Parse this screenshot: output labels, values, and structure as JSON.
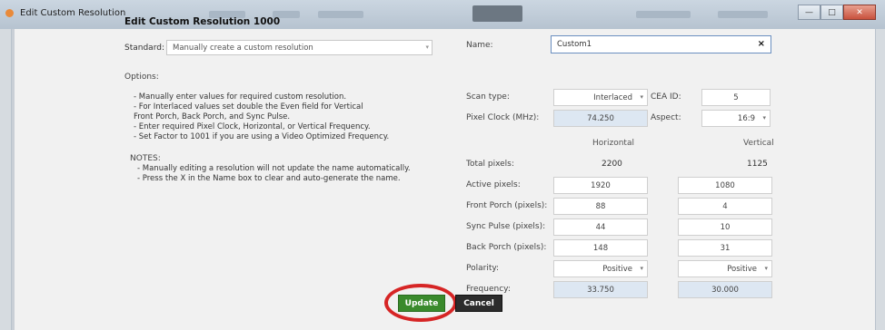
{
  "window": {
    "title": "Edit Custom Resolution"
  },
  "heading": "Edit Custom Resolution 1000",
  "standard": {
    "label": "Standard:",
    "value": "Manually create a custom resolution"
  },
  "options": {
    "label": "Options:",
    "lines": [
      "- Manually enter values for required custom resolution.",
      "- For Interlaced values set double the Even field for Vertical",
      "  Front Porch, Back Porch, and Sync Pulse.",
      "- Enter required Pixel Clock, Horizontal, or Vertical Frequency.",
      "- Set Factor to 1001 if you are using a Video Optimized Frequency."
    ]
  },
  "notes": {
    "label": "NOTES:",
    "lines": [
      "- Manually editing a resolution will not update the name automatically.",
      "- Press the X in the Name box to clear and auto-generate the name."
    ]
  },
  "form": {
    "name_label": "Name:",
    "name_value": "Custom1",
    "name_clear": "×",
    "scan_type_label": "Scan type:",
    "scan_type_value": "Interlaced",
    "cea_label": "CEA ID:",
    "cea_value": "5",
    "pixel_clock_label": "Pixel Clock (MHz):",
    "pixel_clock_value": "74.250",
    "aspect_label": "Aspect:",
    "aspect_value": "16:9",
    "horizontal_label": "Horizontal",
    "vertical_label": "Vertical",
    "rows": {
      "total": {
        "label": "Total pixels:",
        "h": "2200",
        "v": "1125"
      },
      "active": {
        "label": "Active pixels:",
        "h": "1920",
        "v": "1080"
      },
      "front_porch": {
        "label": "Front Porch (pixels):",
        "h": "88",
        "v": "4"
      },
      "sync_pulse": {
        "label": "Sync Pulse (pixels):",
        "h": "44",
        "v": "10"
      },
      "back_porch": {
        "label": "Back Porch (pixels):",
        "h": "148",
        "v": "31"
      },
      "polarity": {
        "label": "Polarity:",
        "h": "Positive",
        "v": "Positive"
      },
      "frequency": {
        "label": "Frequency:",
        "h": "33.750",
        "v": "30.000"
      }
    }
  },
  "buttons": {
    "update": "Update",
    "cancel": "Cancel"
  },
  "icons": {
    "dropdown": "▾"
  }
}
